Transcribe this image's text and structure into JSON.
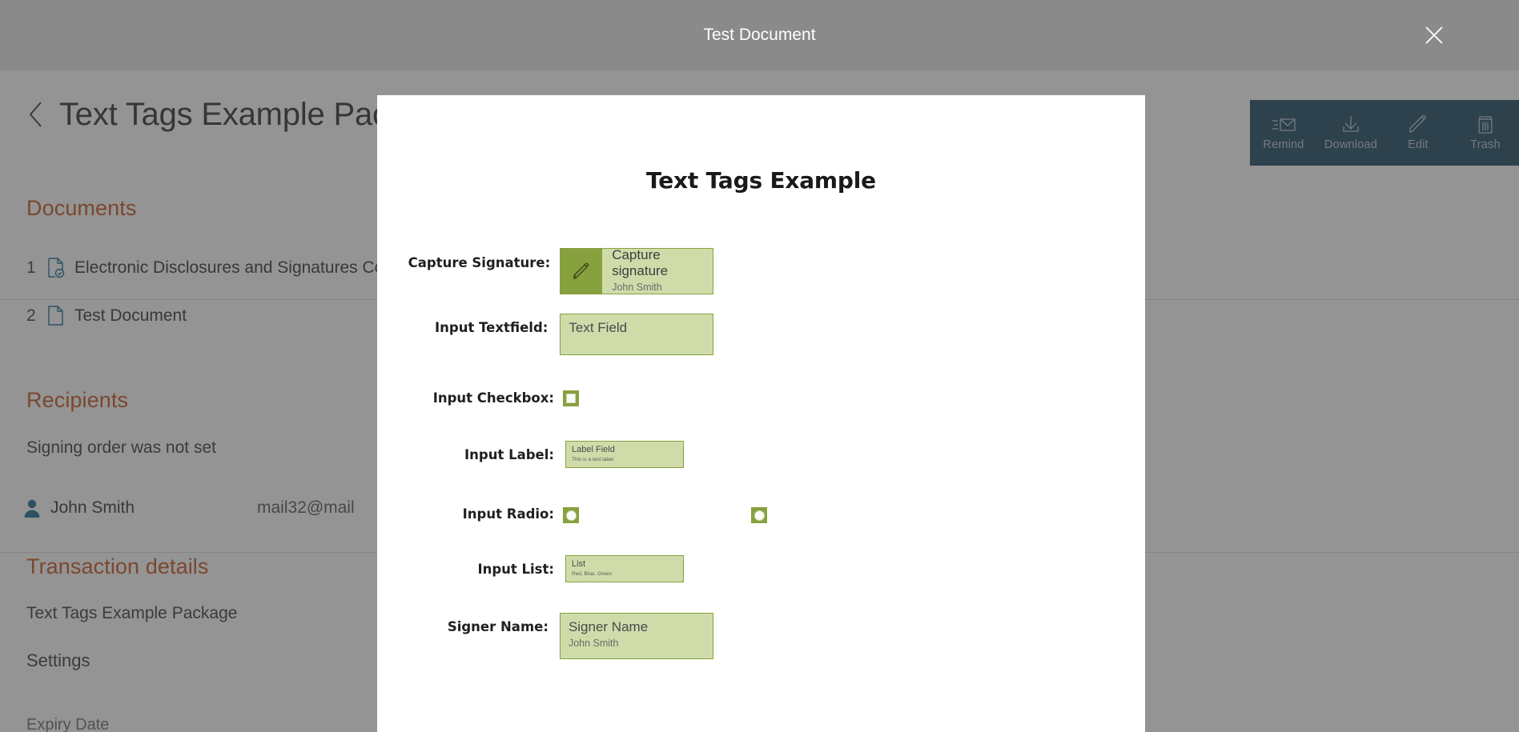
{
  "modal": {
    "title": "Test Document",
    "close_icon": "close-icon"
  },
  "page": {
    "back_icon": "chevron-left-icon",
    "package_title": "Text Tags Example Package",
    "documents": {
      "section_title": "Documents",
      "items": [
        {
          "index": "1",
          "icon": "document-check-icon",
          "label": "Electronic Disclosures and Signatures Consent"
        },
        {
          "index": "2",
          "icon": "document-icon",
          "label": "Test Document"
        }
      ]
    },
    "recipients": {
      "section_title": "Recipients",
      "signing_order_text": "Signing order was not set",
      "items": [
        {
          "avatar_icon": "user-icon",
          "name": "John Smith",
          "email": "mail32@mail"
        }
      ]
    },
    "transaction": {
      "section_title": "Transaction details",
      "package_name": "Text Tags Example Package",
      "settings_label": "Settings",
      "expiry_label": "Expiry Date"
    },
    "actions": [
      {
        "icon": "remind-envelope-icon",
        "label": "Remind"
      },
      {
        "icon": "download-icon",
        "label": "Download"
      },
      {
        "icon": "edit-pencil-icon",
        "label": "Edit"
      },
      {
        "icon": "trash-icon",
        "label": "Trash"
      }
    ]
  },
  "document": {
    "title": "Text Tags Example",
    "fields": [
      {
        "label": "Capture Signature:",
        "type": "signature",
        "icon": "signature-pencil-icon",
        "value": "Capture signature",
        "sub_value": "John Smith"
      },
      {
        "label": "Input Textfield:",
        "type": "textfield",
        "value": "Text Field"
      },
      {
        "label": "Input Checkbox:",
        "type": "checkbox",
        "checked": false
      },
      {
        "label": "Input Label:",
        "type": "label",
        "value": "Label Field",
        "sub_value": "This is a test label"
      },
      {
        "label": "Input Radio:",
        "type": "radio",
        "options": [
          "option-1",
          "option-2"
        ]
      },
      {
        "label": "Input List:",
        "type": "list",
        "value": "List",
        "sub_value": "Red, Blue, Green"
      },
      {
        "label": "Signer Name:",
        "type": "signer",
        "value": "Signer Name",
        "sub_value": "John Smith"
      }
    ]
  },
  "colors": {
    "accent_orange": "#c8561e",
    "toolbar_blue": "#1d4a63",
    "tag_green_fill": "#cfdcaa",
    "tag_green_border": "#8aa03f",
    "tag_green_solid": "#87a13e",
    "icon_blue": "#1d6a96",
    "overlay_gray": "#8a8a8a"
  }
}
